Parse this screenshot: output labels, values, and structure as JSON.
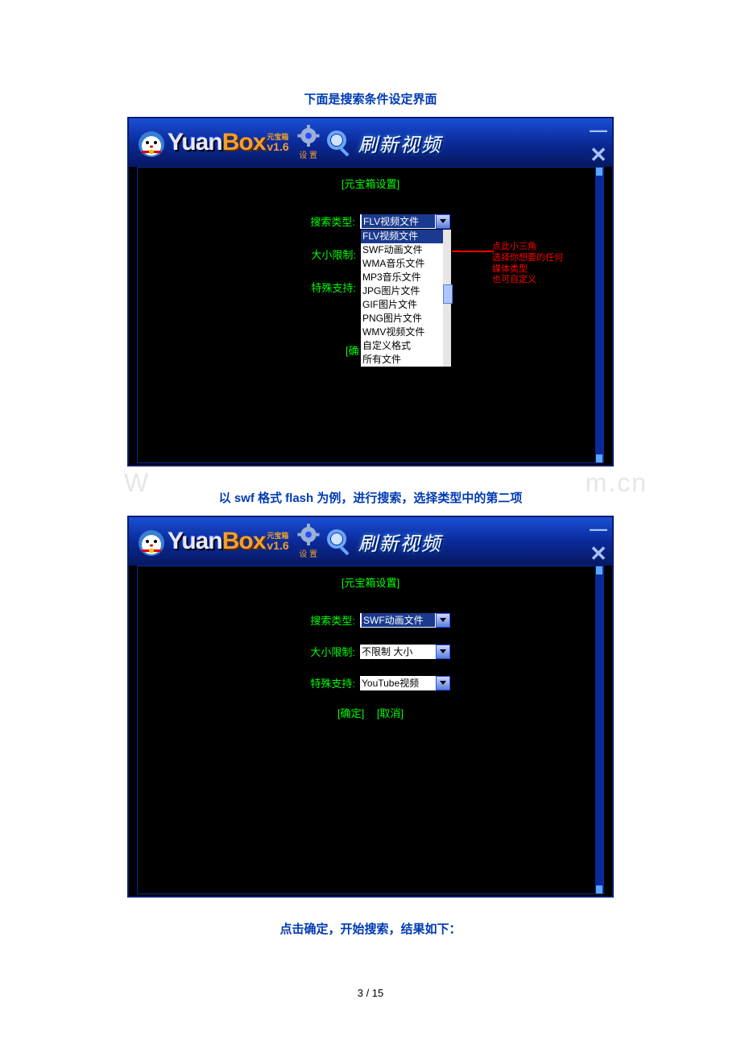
{
  "captions": {
    "top": "下面是搜索条件设定界面",
    "middle": "以 swf 格式 flash 为例，进行搜索，选择类型中的第二项",
    "bottom": "点击确定，开始搜索，结果如下："
  },
  "app": {
    "logo_yuan": "Yuan",
    "logo_box": "Box",
    "logo_cn": "元宝箱",
    "logo_ver": "v1.6",
    "settings_label": "设 置",
    "refresh_label": "刷新视频",
    "panel_title": "[元宝箱设置]",
    "labels": {
      "search_type": "搜索类型:",
      "size_limit": "大小限制:",
      "special": "特殊支持:"
    },
    "confirm": "[确定]",
    "cancel": "[取消]",
    "confirm_partial": "[确"
  },
  "screen1": {
    "selected": "FLV视频文件",
    "options": [
      "FLV视频文件",
      "SWF动画文件",
      "WMA音乐文件",
      "MP3音乐文件",
      "JPG图片文件",
      "GIF图片文件",
      "PNG图片文件",
      "WMV视频文件",
      "自定义格式",
      "所有文件"
    ],
    "annotation_l1": "点此小三角",
    "annotation_l2": "选择你想要的任何",
    "annotation_l3": "媒体类型",
    "annotation_l4": "也可自定义"
  },
  "screen2": {
    "search_type": "SWF动画文件",
    "size_limit": "不限制 大小",
    "special": "YouTube视频"
  },
  "watermark_left": "W",
  "watermark_right": "m.cn",
  "page_number": "3 / 15"
}
